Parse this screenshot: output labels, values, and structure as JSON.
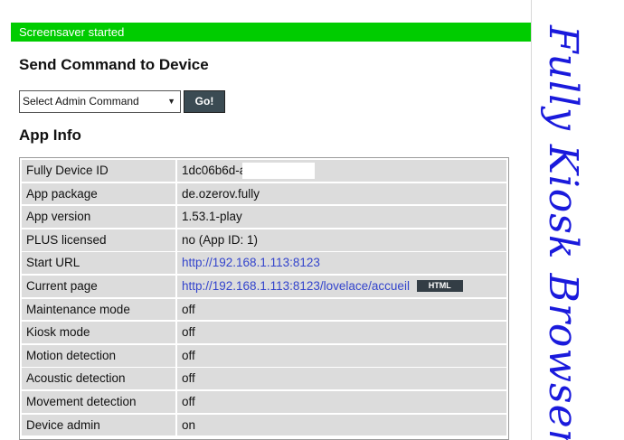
{
  "notification": {
    "text": "Screensaver started",
    "color": "#00cc00"
  },
  "send_command": {
    "title": "Send Command to Device",
    "select_value": "Select Admin Command",
    "go_label": "Go!"
  },
  "app_info": {
    "title": "App Info",
    "rows": [
      {
        "key": "Fully Device ID",
        "value": "1dc06b6d-a"
      },
      {
        "key": "App package",
        "value": "de.ozerov.fully"
      },
      {
        "key": "App version",
        "value": "1.53.1-play"
      },
      {
        "key": "PLUS licensed",
        "value": "no (App ID: 1)"
      },
      {
        "key": "Start URL",
        "value": "http://192.168.1.113:8123"
      },
      {
        "key": "Current page",
        "value": "http://192.168.1.113:8123/lovelace/accueil",
        "badge": "HTML"
      },
      {
        "key": "Maintenance mode",
        "value": "off"
      },
      {
        "key": "Kiosk mode",
        "value": "off"
      },
      {
        "key": "Motion detection",
        "value": "off"
      },
      {
        "key": "Acoustic detection",
        "value": "off"
      },
      {
        "key": "Movement detection",
        "value": "off"
      },
      {
        "key": "Device admin",
        "value": "on"
      }
    ]
  },
  "brand": {
    "text": "Fully Kiosk Browser",
    "color": "#1a1adc"
  },
  "icons": {
    "select_caret": "chevron-down-icon"
  }
}
